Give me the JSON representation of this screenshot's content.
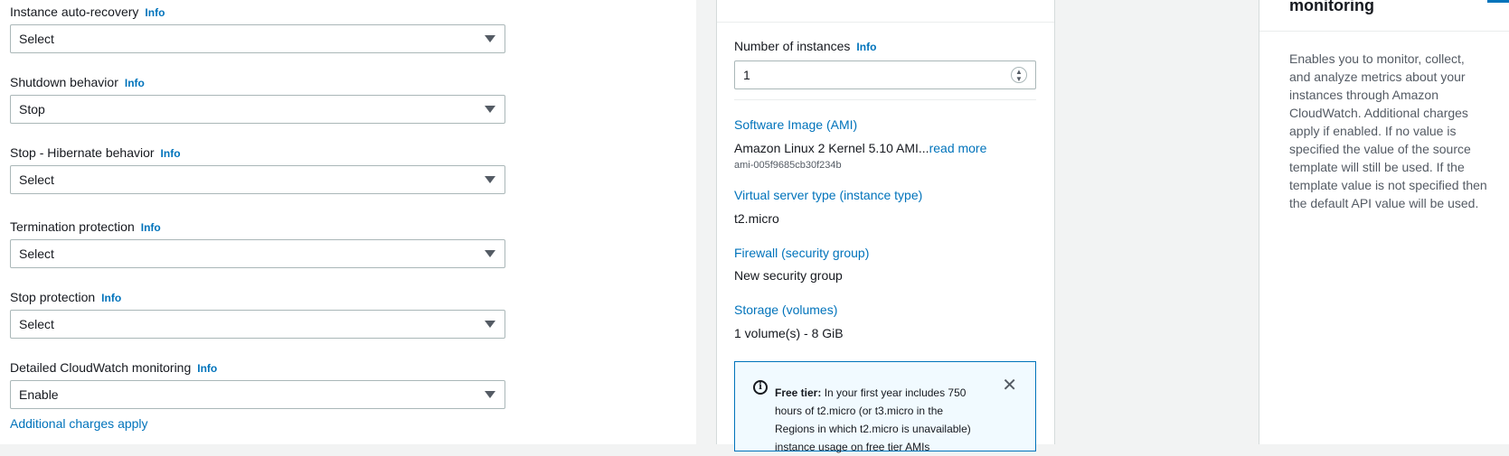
{
  "form": {
    "info_label": "Info",
    "fields": [
      {
        "label": "Instance auto-recovery",
        "value": "Select"
      },
      {
        "label": "Shutdown behavior",
        "value": "Stop"
      },
      {
        "label": "Stop - Hibernate behavior",
        "value": "Select"
      },
      {
        "label": "Termination protection",
        "value": "Select"
      },
      {
        "label": "Stop protection",
        "value": "Select"
      },
      {
        "label": "Detailed CloudWatch monitoring",
        "value": "Enable"
      }
    ],
    "charges_link": "Additional charges apply"
  },
  "summary": {
    "number_label": "Number of instances",
    "info_label": "Info",
    "number_value": "1",
    "ami_heading": "Software Image (AMI)",
    "ami_value": "Amazon Linux 2 Kernel 5.10 AMI...",
    "read_more": "read more",
    "ami_id": "ami-005f9685cb30f234b",
    "type_heading": "Virtual server type (instance type)",
    "type_value": "t2.micro",
    "firewall_heading": "Firewall (security group)",
    "firewall_value": "New security group",
    "storage_heading": "Storage (volumes)",
    "storage_value": "1 volume(s) - 8 GiB",
    "free_tier_label": "Free tier:",
    "free_tier_text": "In your first year includes 750 hours of t2.micro (or t3.micro in the Regions in which t2.micro is unavailable) instance usage on free tier AMIs"
  },
  "help": {
    "title": "monitoring",
    "body": "Enables you to monitor, collect, and analyze metrics about your instances through Amazon CloudWatch. Additional charges apply if enabled. If no value is specified the value of the source template will still be used. If the template value is not specified then the default API value will be used."
  },
  "colors": {
    "link": "#0073bb",
    "border": "#aab7b8",
    "text": "#16191f"
  }
}
